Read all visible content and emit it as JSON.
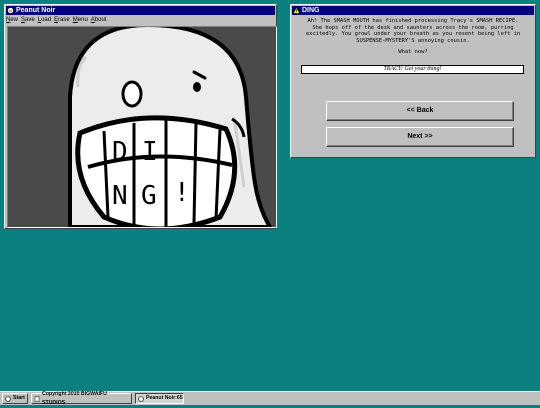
{
  "left_window": {
    "title": "Peanut Noir",
    "icon": "peanut-icon",
    "menu": [
      {
        "label": "New",
        "hot": "N",
        "rest": "ew"
      },
      {
        "label": "Save",
        "hot": "S",
        "rest": "ave"
      },
      {
        "label": "Load",
        "hot": "L",
        "rest": "oad"
      },
      {
        "label": "Erase",
        "hot": "E",
        "rest": "rase"
      },
      {
        "label": "Menu",
        "hot": "M",
        "rest": "enu"
      },
      {
        "label": "About",
        "hot": "A",
        "rest": "bout"
      }
    ],
    "picture": {
      "description_icon": "grinning-peanut-illustration",
      "teeth_letters": [
        "D",
        "I",
        "N",
        "G",
        "!"
      ]
    }
  },
  "right_window": {
    "title": "DING",
    "icon": "warning-triangle-icon",
    "narration": "Ah! The SMASH MOUTH has finished processing Tracy's SMASH RECIPE. She hops off of the desk and saunters across the room, purring excitedly. You growl under your breath as you resent being left in SUSPENSE-MYSTERY'S annoying cousin.",
    "prompt": "What now?",
    "command_value": "TRACY: Get your thing!",
    "back_label": "<< Back",
    "next_label": "Next >>"
  },
  "taskbar": {
    "start_label": "Start",
    "copyright_label": "Copyright 2010 BIGWAIFU STUDIOS",
    "task_label": "Peanut Noir:65"
  },
  "colors": {
    "desktop": "#0b8080",
    "titlebar": "#000080",
    "face": "#c0c0c0"
  }
}
